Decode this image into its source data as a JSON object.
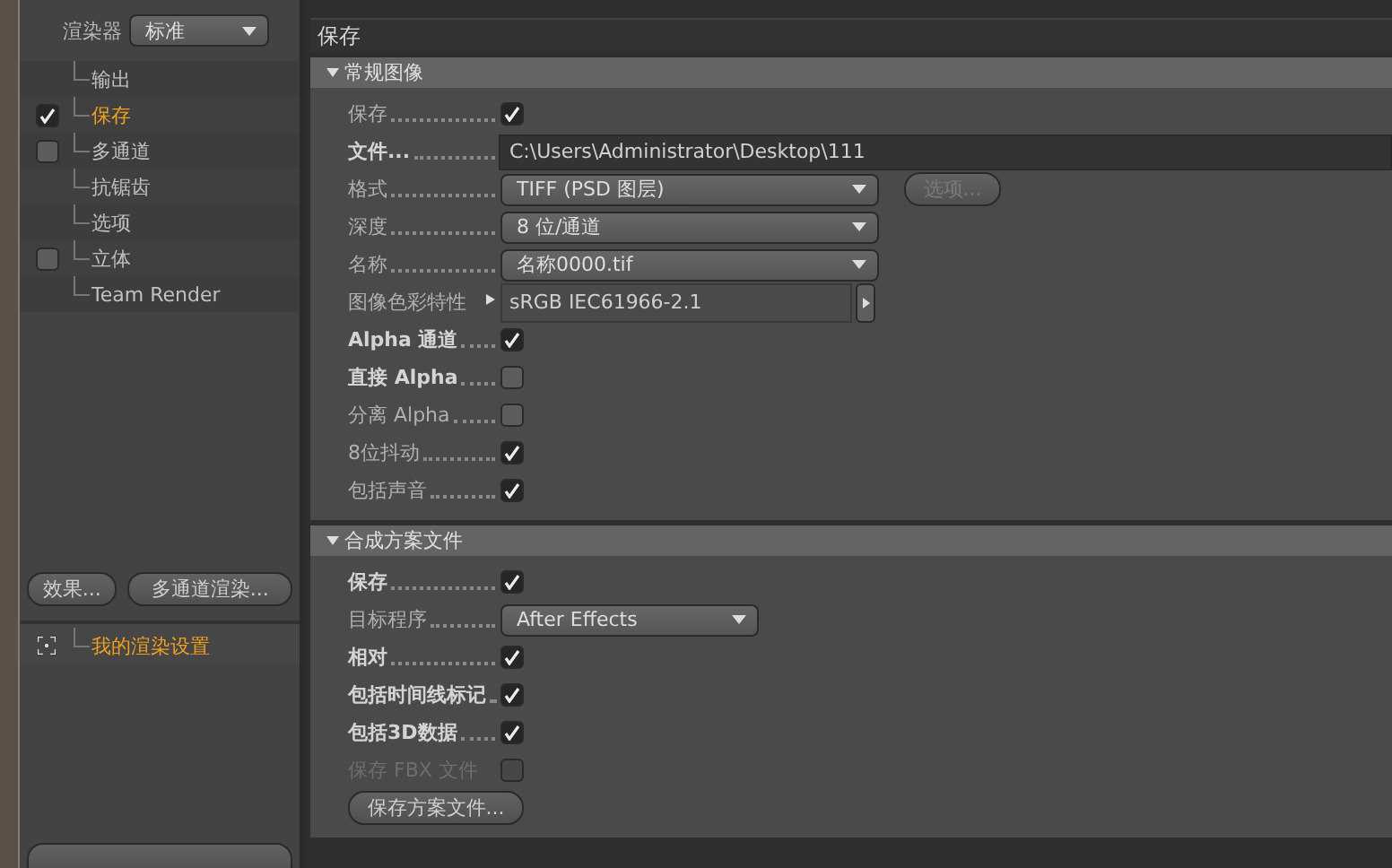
{
  "renderer": {
    "label": "渲染器",
    "value": "标准"
  },
  "sidebar": {
    "items": [
      {
        "label": "输出",
        "kind": "plain",
        "selected": false
      },
      {
        "label": "保存",
        "kind": "check",
        "checked": true,
        "selected": true
      },
      {
        "label": "多通道",
        "kind": "check",
        "checked": false,
        "selected": false
      },
      {
        "label": "抗锯齿",
        "kind": "plain",
        "selected": false
      },
      {
        "label": "选项",
        "kind": "plain",
        "selected": false
      },
      {
        "label": "立体",
        "kind": "check",
        "checked": false,
        "selected": false
      },
      {
        "label": "Team Render",
        "kind": "plain",
        "selected": false
      }
    ],
    "buttons": [
      "效果...",
      "多通道渲染..."
    ],
    "presets": [
      {
        "label": "我的渲染设置",
        "selected": true
      }
    ]
  },
  "panel": {
    "title": "保存",
    "sections": [
      {
        "title": "常规图像",
        "expanded": true,
        "rows": [
          {
            "label": "保存",
            "kind": "check",
            "checked": true,
            "bold": false,
            "disabled": false
          },
          {
            "label": "文件...",
            "kind": "path",
            "value": "C:\\Users\\Administrator\\Desktop\\111",
            "bold": true,
            "disabled": false
          },
          {
            "label": "格式",
            "kind": "dropdown",
            "value": "TIFF (PSD 图层)",
            "button": "选项...",
            "bold": false,
            "disabled": false
          },
          {
            "label": "深度",
            "kind": "dropdown",
            "value": "8 位/通道",
            "bold": false,
            "disabled": false
          },
          {
            "label": "名称",
            "kind": "dropdown",
            "value": "名称0000.tif",
            "bold": false,
            "disabled": false
          },
          {
            "label": "图像色彩特性",
            "kind": "profile",
            "value": "sRGB IEC61966-2.1",
            "bold": false,
            "disabled": false
          },
          {
            "label": "Alpha 通道",
            "kind": "check",
            "checked": true,
            "bold": true,
            "disabled": false
          },
          {
            "label": "直接 Alpha",
            "kind": "check",
            "checked": false,
            "bold": true,
            "disabled": false
          },
          {
            "label": "分离 Alpha",
            "kind": "check",
            "checked": false,
            "bold": false,
            "disabled": false
          },
          {
            "label": "8位抖动",
            "kind": "check",
            "checked": true,
            "bold": false,
            "disabled": false
          },
          {
            "label": "包括声音",
            "kind": "check",
            "checked": true,
            "bold": false,
            "disabled": false
          }
        ]
      },
      {
        "title": "合成方案文件",
        "expanded": true,
        "rows": [
          {
            "label": "保存",
            "kind": "check",
            "checked": true,
            "bold": true,
            "disabled": false
          },
          {
            "label": "目标程序",
            "kind": "dropdown",
            "value": "After Effects",
            "wide": false,
            "bold": false,
            "disabled": false
          },
          {
            "label": "相对",
            "kind": "check",
            "checked": true,
            "bold": true,
            "disabled": false
          },
          {
            "label": "包括时间线标记",
            "kind": "check",
            "checked": true,
            "bold": true,
            "disabled": false
          },
          {
            "label": "包括3D数据",
            "kind": "check",
            "checked": true,
            "bold": true,
            "disabled": false
          },
          {
            "label": "保存 FBX 文件",
            "kind": "check",
            "checked": false,
            "bold": false,
            "disabled": true
          },
          {
            "label": "保存方案文件...",
            "kind": "button"
          }
        ]
      }
    ]
  }
}
